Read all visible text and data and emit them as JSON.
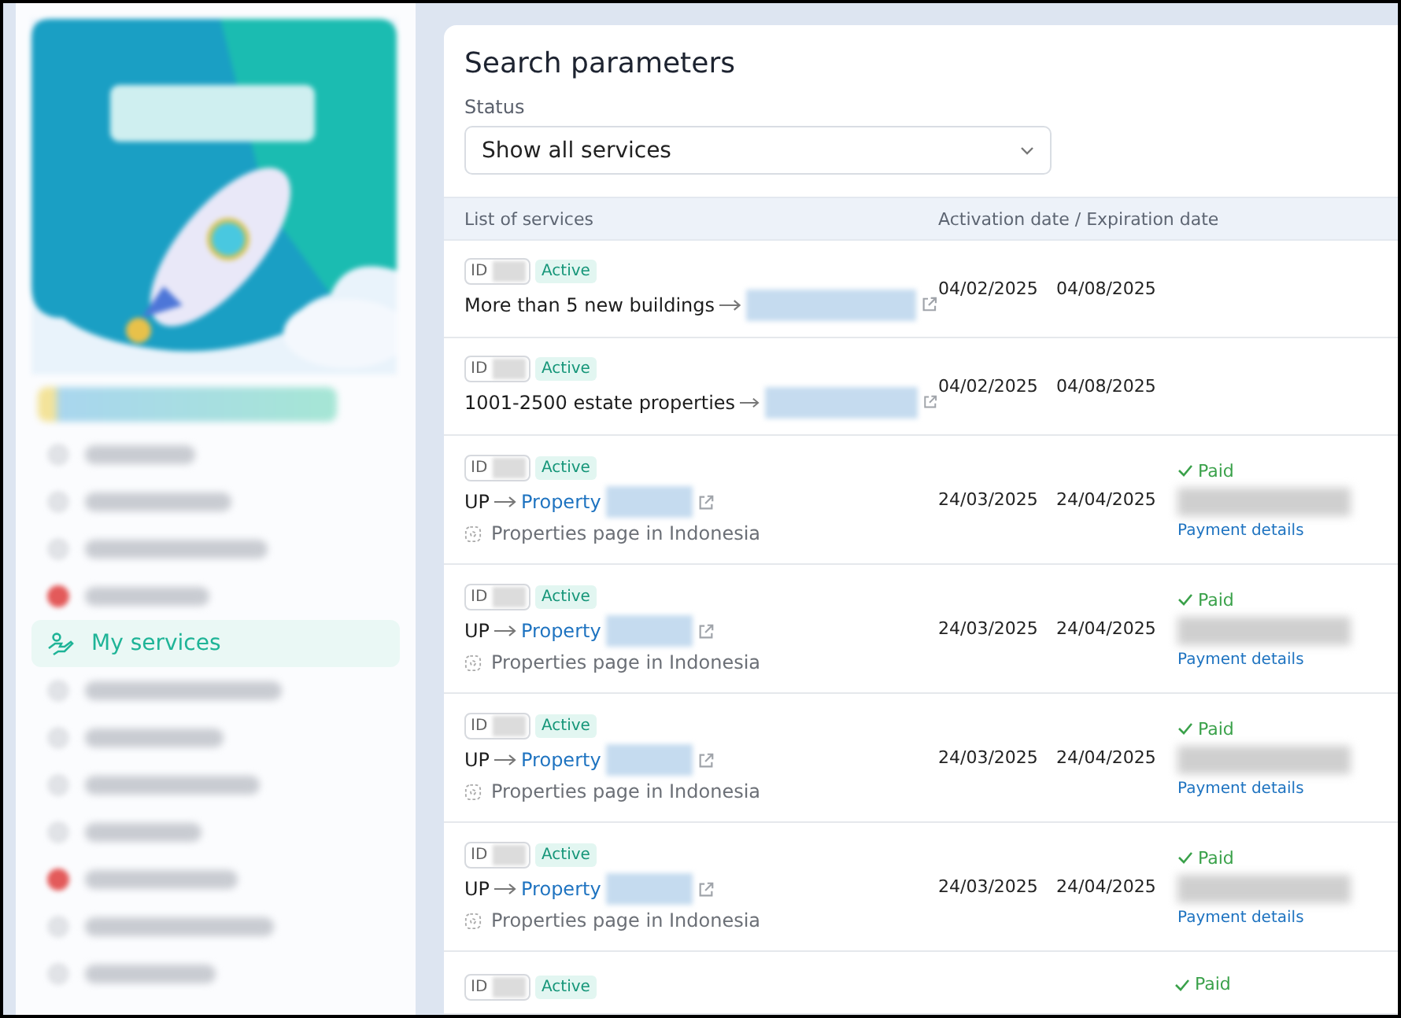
{
  "sidebar": {
    "items": [
      {
        "kind": "redacted",
        "alert": false,
        "selected": false
      },
      {
        "kind": "redacted",
        "alert": false,
        "selected": false
      },
      {
        "kind": "redacted",
        "alert": false,
        "selected": false
      },
      {
        "kind": "redacted",
        "alert": true,
        "selected": false
      },
      {
        "kind": "label",
        "label": "My services",
        "selected": true
      },
      {
        "kind": "redacted",
        "alert": false,
        "selected": false
      },
      {
        "kind": "redacted",
        "alert": false,
        "selected": false
      },
      {
        "kind": "redacted",
        "alert": false,
        "selected": false
      },
      {
        "kind": "redacted",
        "alert": false,
        "selected": false
      },
      {
        "kind": "redacted",
        "alert": true,
        "selected": false
      },
      {
        "kind": "redacted",
        "alert": false,
        "selected": false
      },
      {
        "kind": "redacted",
        "alert": false,
        "selected": false
      }
    ]
  },
  "search": {
    "title": "Search parameters",
    "status_label": "Status",
    "status_value": "Show all services"
  },
  "table": {
    "columns": [
      "List of services",
      "Activation date / Expiration date"
    ],
    "rows": [
      {
        "kind": "plain",
        "id_label": "ID",
        "status": "Active",
        "title": "More than 5 new buildings",
        "activation": "04/02/2025",
        "expiration": "04/08/2025"
      },
      {
        "kind": "plain",
        "id_label": "ID",
        "status": "Active",
        "title": "1001-2500 estate properties",
        "activation": "04/02/2025",
        "expiration": "04/08/2025"
      },
      {
        "kind": "property",
        "id_label": "ID",
        "status": "Active",
        "prefix": "UP",
        "link": "Property",
        "subtitle": "Properties page in Indonesia",
        "activation": "24/03/2025",
        "expiration": "24/04/2025",
        "payment": "Paid",
        "details": "Payment details"
      },
      {
        "kind": "property",
        "id_label": "ID",
        "status": "Active",
        "prefix": "UP",
        "link": "Property",
        "subtitle": "Properties page in Indonesia",
        "activation": "24/03/2025",
        "expiration": "24/04/2025",
        "payment": "Paid",
        "details": "Payment details"
      },
      {
        "kind": "property",
        "id_label": "ID",
        "status": "Active",
        "prefix": "UP",
        "link": "Property",
        "subtitle": "Properties page in Indonesia",
        "activation": "24/03/2025",
        "expiration": "24/04/2025",
        "payment": "Paid",
        "details": "Payment details"
      },
      {
        "kind": "property",
        "id_label": "ID",
        "status": "Active",
        "prefix": "UP",
        "link": "Property",
        "subtitle": "Properties page in Indonesia",
        "activation": "24/03/2025",
        "expiration": "24/04/2025",
        "payment": "Paid",
        "details": "Payment details"
      },
      {
        "kind": "cut",
        "id_label": "ID",
        "status": "Active",
        "payment": "Paid"
      }
    ]
  }
}
